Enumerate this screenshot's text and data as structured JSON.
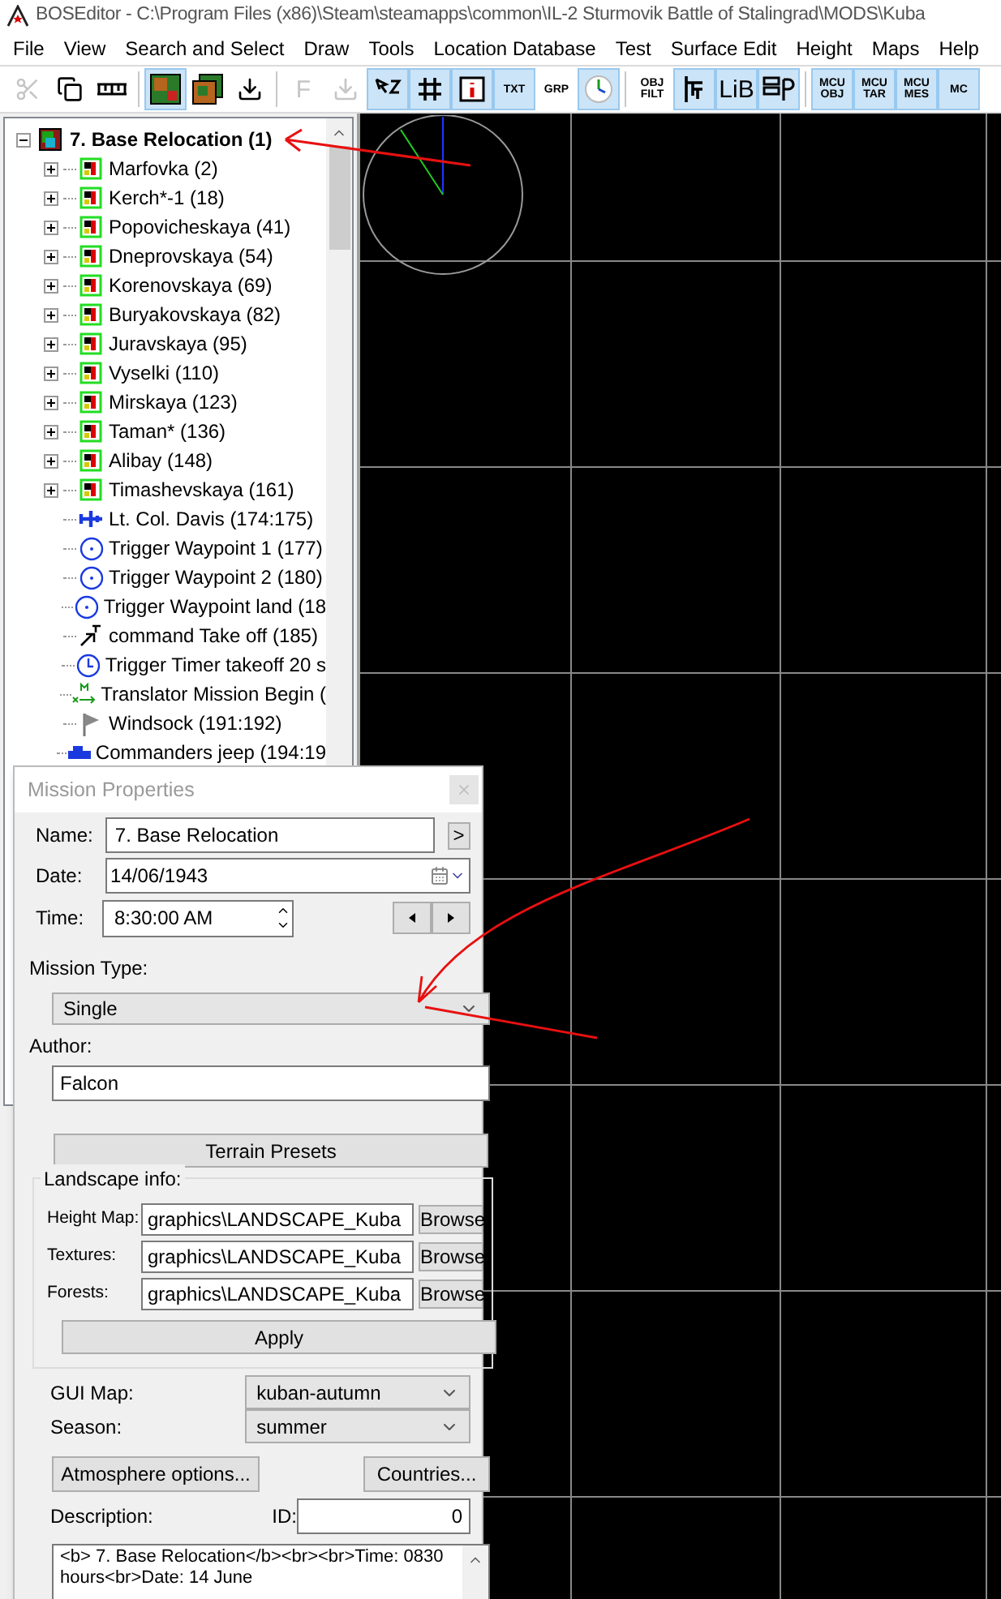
{
  "window": {
    "title": "BOSEditor - C:\\Program Files (x86)\\Steam\\steamapps\\common\\IL-2 Sturmovik Battle of Stalingrad\\MODS\\Kuba"
  },
  "menu": [
    "File",
    "View",
    "Search and Select",
    "Draw",
    "Tools",
    "Location Database",
    "Test",
    "Surface Edit",
    "Height",
    "Maps",
    "Help"
  ],
  "toolbar": [
    {
      "kind": "cut",
      "selected": false,
      "disabled": true
    },
    {
      "kind": "copy",
      "selected": false,
      "disabled": false
    },
    {
      "kind": "ruler",
      "selected": false,
      "disabled": false
    },
    {
      "kind": "separator"
    },
    {
      "kind": "map",
      "selected": true,
      "disabled": false
    },
    {
      "kind": "map-layers",
      "selected": false,
      "disabled": false
    },
    {
      "kind": "download",
      "selected": false,
      "disabled": false
    },
    {
      "kind": "separator"
    },
    {
      "kind": "text",
      "label": "F",
      "selected": false,
      "disabled": true
    },
    {
      "kind": "download",
      "selected": false,
      "disabled": true
    },
    {
      "kind": "pointer",
      "selected": true,
      "disabled": false
    },
    {
      "kind": "grid",
      "selected": true,
      "disabled": false
    },
    {
      "kind": "info",
      "selected": true,
      "disabled": false
    },
    {
      "kind": "small-text",
      "label": "TXT",
      "selected": true,
      "disabled": false
    },
    {
      "kind": "small-text",
      "label": "GRP",
      "selected": false,
      "disabled": false
    },
    {
      "kind": "clock",
      "selected": true,
      "disabled": false
    },
    {
      "kind": "separator"
    },
    {
      "kind": "small-text",
      "label": "OBJ FILT",
      "selected": false,
      "disabled": false
    },
    {
      "kind": "filter",
      "selected": true,
      "disabled": false
    },
    {
      "kind": "text",
      "label": "LiB",
      "selected": true,
      "disabled": false
    },
    {
      "kind": "layout",
      "selected": true,
      "disabled": false
    },
    {
      "kind": "separator"
    },
    {
      "kind": "small-text",
      "label": "MCU OBJ",
      "selected": true,
      "disabled": false
    },
    {
      "kind": "small-text",
      "label": "MCU TAR",
      "selected": true,
      "disabled": false
    },
    {
      "kind": "small-text",
      "label": "MCU MES",
      "selected": true,
      "disabled": false
    },
    {
      "kind": "small-text",
      "label": "MC",
      "selected": true,
      "disabled": false
    }
  ],
  "tree": {
    "label": "7. Base Relocation (1)",
    "expanded": true,
    "children": [
      {
        "kind": "group",
        "label": "Marfovka (2)",
        "expanded": false
      },
      {
        "kind": "group",
        "label": "Kerch*-1 (18)",
        "expanded": false
      },
      {
        "kind": "group",
        "label": "Popovicheskaya (41)",
        "expanded": false
      },
      {
        "kind": "group",
        "label": "Dneprovskaya (54)",
        "expanded": false
      },
      {
        "kind": "group",
        "label": "Korenovskaya (69)",
        "expanded": false
      },
      {
        "kind": "group",
        "label": "Buryakovskaya (82)",
        "expanded": false
      },
      {
        "kind": "group",
        "label": "Juravskaya (95)",
        "expanded": false
      },
      {
        "kind": "group",
        "label": "Vyselki (110)",
        "expanded": false
      },
      {
        "kind": "group",
        "label": "Mirskaya (123)",
        "expanded": false
      },
      {
        "kind": "group",
        "label": "Taman* (136)",
        "expanded": false
      },
      {
        "kind": "group",
        "label": "Alibay (148)",
        "expanded": false
      },
      {
        "kind": "group",
        "label": "Timashevskaya (161)",
        "expanded": false
      },
      {
        "kind": "plane",
        "label": "Lt. Col. Davis (174:175)"
      },
      {
        "kind": "waypoint",
        "label": "Trigger Waypoint 1 (177)"
      },
      {
        "kind": "waypoint",
        "label": "Trigger Waypoint 2 (180)"
      },
      {
        "kind": "waypoint",
        "label": "Trigger Waypoint land (18"
      },
      {
        "kind": "command",
        "label": "command Take off (185)"
      },
      {
        "kind": "timer",
        "label": "Trigger Timer takeoff 20 s"
      },
      {
        "kind": "translator",
        "label": "Translator Mission Begin ("
      },
      {
        "kind": "flag",
        "label": "Windsock (191:192)"
      },
      {
        "kind": "vehicle",
        "label": "Commanders jeep (194:19"
      }
    ]
  },
  "mission_properties": {
    "title": "Mission Properties",
    "name": {
      "label": "Name:",
      "value": "7. Base Relocation",
      "button": ">"
    },
    "date": {
      "label": "Date:",
      "value": "14/06/1943"
    },
    "time": {
      "label": "Time:",
      "value": "8:30:00 AM"
    },
    "mission_type": {
      "label": "Mission Type:",
      "value": "Single"
    },
    "author": {
      "label": "Author:",
      "value": "Falcon"
    },
    "terrain_presets": "Terrain Presets",
    "landscape": {
      "title": "Landscape info:",
      "fields": [
        {
          "label": "Height Map:",
          "value": "graphics\\LANDSCAPE_Kuba",
          "button": "Browse"
        },
        {
          "label": "Textures:",
          "value": "graphics\\LANDSCAPE_Kuba",
          "button": "Browse"
        },
        {
          "label": "Forests:",
          "value": "graphics\\LANDSCAPE_Kuba",
          "button": "Browse"
        }
      ],
      "apply": "Apply"
    },
    "gui_map": {
      "label": "GUI Map:",
      "value": "kuban-autumn"
    },
    "season": {
      "label": "Season:",
      "value": "summer"
    },
    "atmosphere_button": "Atmosphere options...",
    "countries_button": "Countries...",
    "description": {
      "label": "Description:",
      "text": "<b> 7. Base Relocation</b><br><br>Time: 0830 hours<br>Date: 14 June"
    },
    "id": {
      "label": "ID:",
      "value": "0"
    }
  }
}
